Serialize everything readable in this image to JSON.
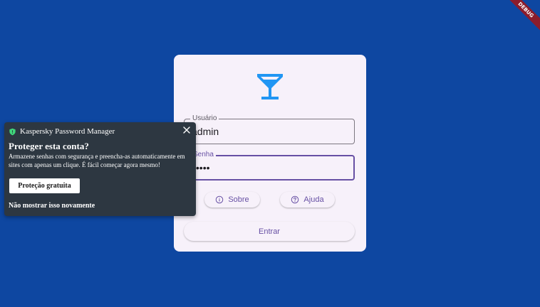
{
  "colors": {
    "background": "#0e47a1",
    "card": "#f7f1fa",
    "accent": "#6750a4",
    "logo": "#2196f3",
    "popup": "#2d3741",
    "ribbon": "#8b1c2c"
  },
  "debug_banner": "DEBUG",
  "login": {
    "logo_icon": "cocktail-glass-icon",
    "username_label": "Usuário",
    "username_value": "admin",
    "password_label": "Senha",
    "password_value": "admin",
    "about_label": "Sobre",
    "about_icon": "info-icon",
    "help_label": "Ajuda",
    "help_icon": "help-circle-icon",
    "submit_label": "Entrar"
  },
  "kaspersky_popup": {
    "app_name": "Kaspersky Password Manager",
    "app_icon": "shield-icon",
    "close_icon": "close-icon",
    "title": "Proteger esta conta?",
    "description": "Armazene senhas com segurança e preencha-as automaticamente em sites com apenas um clique. É fácil começar agora mesmo!",
    "primary_button": "Proteção gratuita",
    "dismiss_link": "Não mostrar isso novamente"
  }
}
